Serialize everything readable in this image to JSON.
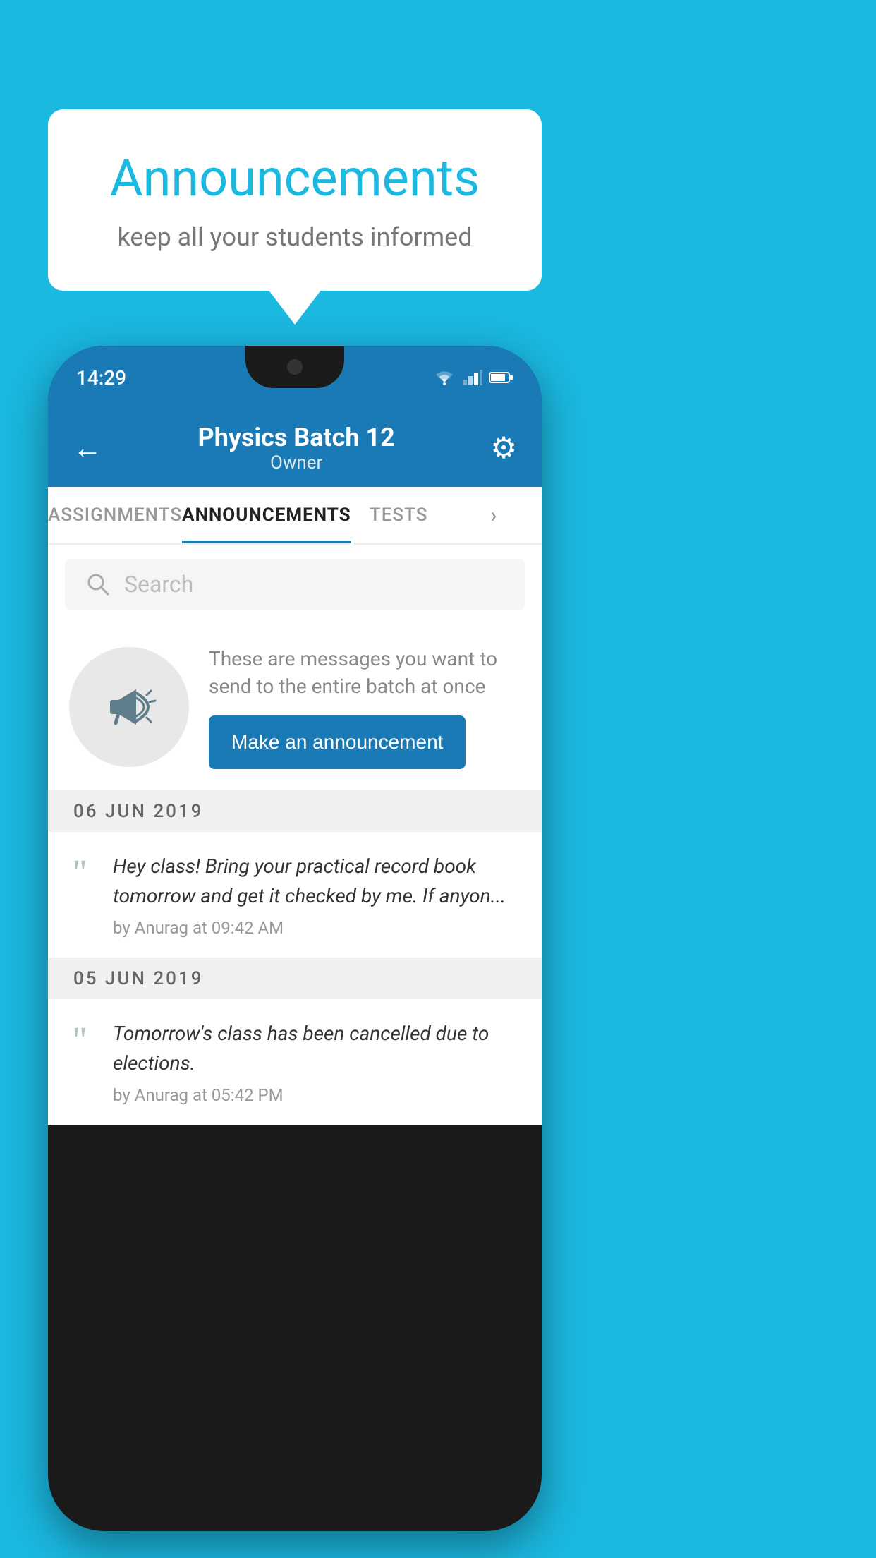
{
  "background_color": "#1bb8e0",
  "speech_bubble": {
    "title": "Announcements",
    "subtitle": "keep all your students informed"
  },
  "status_bar": {
    "time": "14:29",
    "icons": [
      "wifi",
      "signal",
      "battery"
    ]
  },
  "header": {
    "title": "Physics Batch 12",
    "subtitle": "Owner",
    "back_label": "←",
    "gear_label": "⚙"
  },
  "tabs": [
    {
      "label": "ASSIGNMENTS",
      "active": false
    },
    {
      "label": "ANNOUNCEMENTS",
      "active": true
    },
    {
      "label": "TESTS",
      "active": false
    },
    {
      "label": "···",
      "active": false
    }
  ],
  "search": {
    "placeholder": "Search"
  },
  "intro": {
    "text": "These are messages you want to send to the entire batch at once",
    "button_label": "Make an announcement"
  },
  "announcements": [
    {
      "date": "06  JUN  2019",
      "text": "Hey class! Bring your practical record book tomorrow and get it checked by me. If anyon...",
      "meta": "by Anurag at 09:42 AM"
    },
    {
      "date": "05  JUN  2019",
      "text": "Tomorrow's class has been cancelled due to elections.",
      "meta": "by Anurag at 05:42 PM"
    }
  ]
}
